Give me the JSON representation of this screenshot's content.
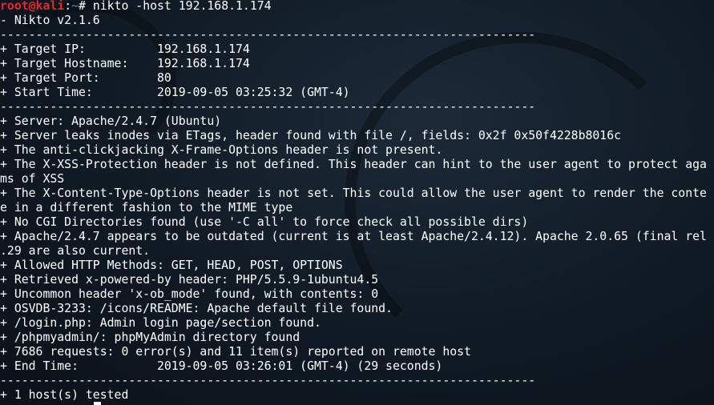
{
  "prompt": {
    "user_host": "root@kali",
    "sep": ":",
    "dir": "~",
    "command": "# nikto -host 192.168.1.174"
  },
  "lines": [
    "- Nikto v2.1.6",
    "---------------------------------------------------------------------------",
    "+ Target IP:          192.168.1.174",
    "+ Target Hostname:    192.168.1.174",
    "+ Target Port:        80",
    "+ Start Time:         2019-09-05 03:25:32 (GMT-4)",
    "---------------------------------------------------------------------------",
    "+ Server: Apache/2.4.7 (Ubuntu)",
    "+ Server leaks inodes via ETags, header found with file /, fields: 0x2f 0x50f4228b8016c",
    "+ The anti-clickjacking X-Frame-Options header is not present.",
    "+ The X-XSS-Protection header is not defined. This header can hint to the user agent to protect aga",
    "ms of XSS",
    "+ The X-Content-Type-Options header is not set. This could allow the user agent to render the conte",
    "e in a different fashion to the MIME type",
    "+ No CGI Directories found (use '-C all' to force check all possible dirs)",
    "+ Apache/2.4.7 appears to be outdated (current is at least Apache/2.4.12). Apache 2.0.65 (final rel",
    ".29 are also current.",
    "+ Allowed HTTP Methods: GET, HEAD, POST, OPTIONS",
    "+ Retrieved x-powered-by header: PHP/5.5.9-1ubuntu4.5",
    "+ Uncommon header 'x-ob_mode' found, with contents: 0",
    "+ OSVDB-3233: /icons/README: Apache default file found.",
    "+ /login.php: Admin login page/section found.",
    "+ /phpmyadmin/: phpMyAdmin directory found",
    "+ 7686 requests: 0 error(s) and 11 item(s) reported on remote host",
    "+ End Time:           2019-09-05 03:26:01 (GMT-4) (29 seconds)",
    "---------------------------------------------------------------------------",
    "+ 1 host(s) tested"
  ]
}
